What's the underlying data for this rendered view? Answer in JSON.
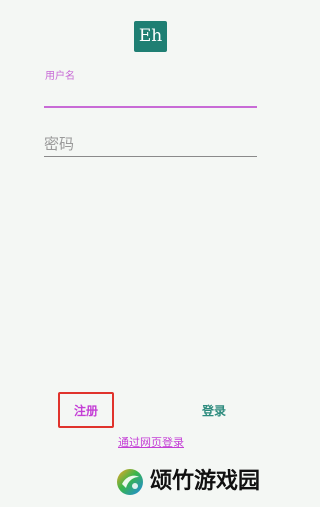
{
  "app": {
    "logo_text": "Eh",
    "logo_color": "#1f7f73"
  },
  "login_form": {
    "username_label": "用户名",
    "username_value": "",
    "password_placeholder": "密码",
    "password_value": ""
  },
  "actions": {
    "register_label": "注册",
    "login_label": "登录",
    "web_login_label": "通过网页登录"
  },
  "watermark": {
    "text": "颂竹游戏园",
    "icon": "bamboo-logo-icon"
  },
  "colors": {
    "accent": "#c86bd6",
    "login_text": "#2c8b7d",
    "highlight_box": "#e0332c",
    "background": "#f4f7f4"
  }
}
